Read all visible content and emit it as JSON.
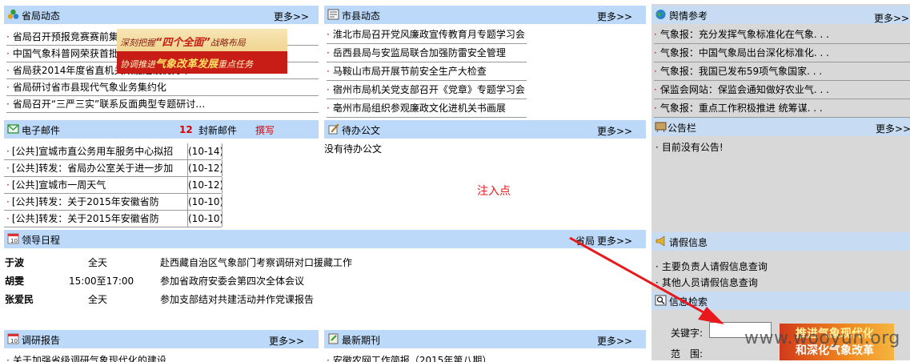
{
  "more": "更多>>",
  "province_news": {
    "title": "省局动态",
    "items": [
      "省局召开预报竞赛赛前集",
      "中国气象科普网荣获首批",
      "省局获2014年度省直机关效能建设优秀单",
      "省局研讨省市县现代气象业务集约化",
      "省局召开“三严三实”联系反面典型专题研讨…"
    ],
    "banner": {
      "line1_a": "深刻把握",
      "line1_b": "“四个全面”",
      "line1_c": "战略布局",
      "line2_a": "协调推进",
      "line2_b": "气象改革发展",
      "line2_c": "重点任务"
    }
  },
  "county_news": {
    "title": "市县动态",
    "items": [
      "淮北市局召开党风廉政宣传教育月专题学习会",
      "岳西县局与安监局联合加强防雷安全管理",
      "马鞍山市局开展节前安全生产大检查",
      "宿州市局机关党支部召开《党章》专题学习会",
      "亳州市局组织参观廉政文化进机关书画展"
    ]
  },
  "public_opinion": {
    "title": "舆情参考",
    "items": [
      "气象报：充分发挥气象标准化在气象. . .",
      "气象报：中国气象局出台深化标准化. . .",
      "气象报：我国已发布59项气象国家. . .",
      "保监会网站：保监会通知做好农业气. . .",
      "气象报：重点工作积极推进 统筹谋. . ."
    ]
  },
  "email": {
    "title": "电子邮件",
    "count": "12",
    "count_label": "封新邮件",
    "compose": "撰写",
    "items": [
      {
        "subject": "[公共]宣城市直公务用车服务中心拟招",
        "date": "(10-14)"
      },
      {
        "subject": "[公共]转发：省局办公室关于进一步加",
        "date": "(10-12)"
      },
      {
        "subject": "[公共]宣城市一周天气",
        "date": "(10-12)"
      },
      {
        "subject": "[公共]转发：关于2015年安徽省防",
        "date": "(10-10)"
      },
      {
        "subject": "[公共]转发：关于2015年安徽省防",
        "date": "(10-10)"
      }
    ]
  },
  "pending_docs": {
    "title": "待办公文",
    "empty": "没有待办公文",
    "injection_note": "注入点"
  },
  "bulletin": {
    "title": "公告栏",
    "items": [
      "目前没有公告!"
    ]
  },
  "schedule": {
    "title": "领导日程",
    "org": "省局",
    "rows": [
      {
        "name": "于波",
        "time": "全天",
        "event": "赴西藏自治区气象部门考察调研对口援藏工作"
      },
      {
        "name": "胡雯",
        "time": "15:00至17:00",
        "event": "参加省政府安委会第四次全体会议"
      },
      {
        "name": "张爱民",
        "time": "全天",
        "event": "参加支部结对共建活动并作党课报告"
      }
    ]
  },
  "leave_info": {
    "title": "请假信息",
    "items": [
      "主要负责人请假信息查询",
      "其他人员请假信息查询"
    ]
  },
  "info_search": {
    "title": "信息检索",
    "keyword_label": "关键字:",
    "range_label": "范　围:",
    "keyword_value": "",
    "banner_line1": "推进气象现代化",
    "banner_line2": "和深化气象改革"
  },
  "research": {
    "title": "调研报告",
    "partial_item": "关于加强省级调研气象现代化的建设"
  },
  "journal": {
    "title": "最新期刊",
    "partial_item": "安徽农网工作简报（2015年第八期）"
  },
  "watermark": "www.wooyun.org",
  "colors": {
    "header_bg": "#bcd9f9",
    "bullet": "#cc0000",
    "arrow": "#e8191d",
    "right_bg": "#d8d8d8"
  }
}
